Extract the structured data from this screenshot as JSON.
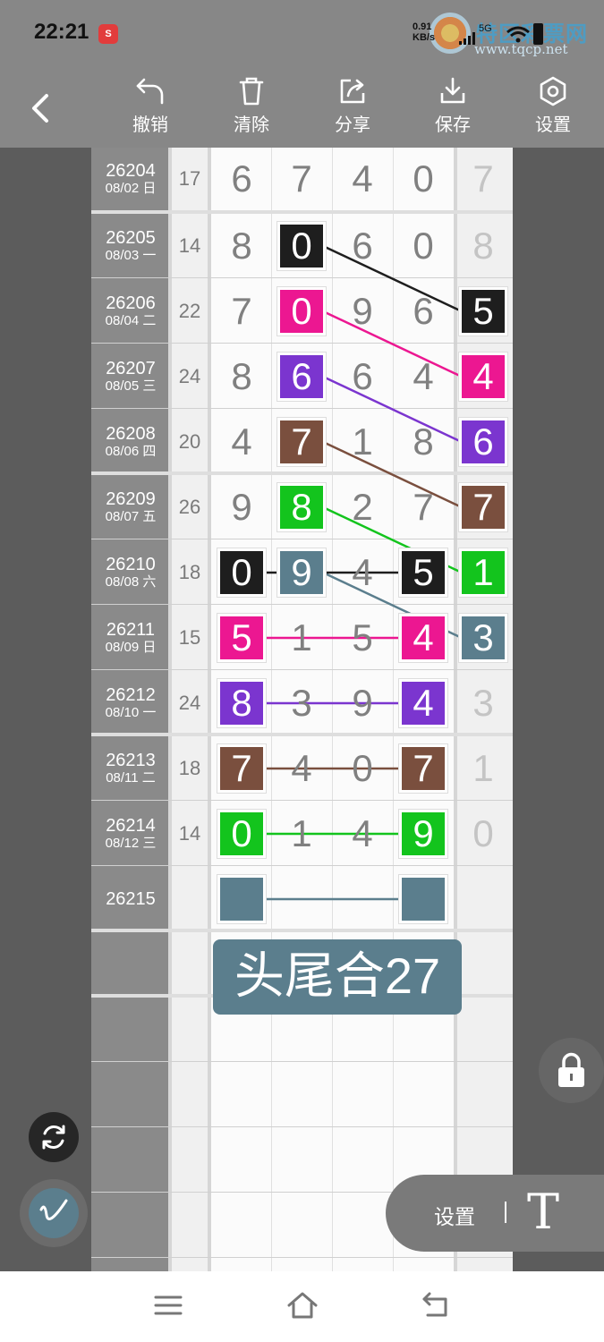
{
  "status_bar": {
    "time": "22:21",
    "app_badge": "S",
    "net_speed": "0.91",
    "net_unit": "KB/s",
    "signal": "5G",
    "watermark_title": "特区彩票网",
    "watermark_url": "www.tqcp.net"
  },
  "toolbar": {
    "undo_label": "撤销",
    "clear_label": "清除",
    "share_label": "分享",
    "save_label": "保存",
    "settings_label": "设置"
  },
  "colors": {
    "black": "#1e1e1e",
    "magenta": "#ec1791",
    "purple": "#7b35cf",
    "brown": "#7a4f3e",
    "green": "#13c41d",
    "teal": "#5b7e8d"
  },
  "rows": [
    {
      "issue": "26204",
      "date": "08/02 日",
      "sum": "17",
      "digits": [
        "6",
        "7",
        "4",
        "0"
      ],
      "tail": "7",
      "hl": [
        null,
        null,
        null,
        null
      ],
      "tail_hl": null
    },
    {
      "issue": "26205",
      "date": "08/03 一",
      "sum": "14",
      "digits": [
        "8",
        "0",
        "6",
        "0"
      ],
      "tail": "8",
      "hl": [
        null,
        "black",
        null,
        null
      ],
      "tail_hl": null
    },
    {
      "issue": "26206",
      "date": "08/04 二",
      "sum": "22",
      "digits": [
        "7",
        "0",
        "9",
        "6"
      ],
      "tail": "5",
      "hl": [
        null,
        "magenta",
        null,
        null
      ],
      "tail_hl": "black"
    },
    {
      "issue": "26207",
      "date": "08/05 三",
      "sum": "24",
      "digits": [
        "8",
        "6",
        "6",
        "4"
      ],
      "tail": "4",
      "hl": [
        null,
        "purple",
        null,
        null
      ],
      "tail_hl": "magenta"
    },
    {
      "issue": "26208",
      "date": "08/06 四",
      "sum": "20",
      "digits": [
        "4",
        "7",
        "1",
        "8"
      ],
      "tail": "6",
      "hl": [
        null,
        "brown",
        null,
        null
      ],
      "tail_hl": "purple"
    },
    {
      "issue": "26209",
      "date": "08/07 五",
      "sum": "26",
      "digits": [
        "9",
        "8",
        "2",
        "7"
      ],
      "tail": "7",
      "hl": [
        null,
        "green",
        null,
        null
      ],
      "tail_hl": "brown"
    },
    {
      "issue": "26210",
      "date": "08/08 六",
      "sum": "18",
      "digits": [
        "0",
        "9",
        "4",
        "5"
      ],
      "tail": "1",
      "hl": [
        "black",
        "teal",
        null,
        "black"
      ],
      "tail_hl": "green"
    },
    {
      "issue": "26211",
      "date": "08/09 日",
      "sum": "15",
      "digits": [
        "5",
        "1",
        "5",
        "4"
      ],
      "tail": "3",
      "hl": [
        "magenta",
        null,
        null,
        "magenta"
      ],
      "tail_hl": "teal"
    },
    {
      "issue": "26212",
      "date": "08/10 一",
      "sum": "24",
      "digits": [
        "8",
        "3",
        "9",
        "4"
      ],
      "tail": "3",
      "hl": [
        "purple",
        null,
        null,
        "purple"
      ],
      "tail_hl": null
    },
    {
      "issue": "26213",
      "date": "08/11 二",
      "sum": "18",
      "digits": [
        "7",
        "4",
        "0",
        "7"
      ],
      "tail": "1",
      "hl": [
        "brown",
        null,
        null,
        "brown"
      ],
      "tail_hl": null
    },
    {
      "issue": "26214",
      "date": "08/12 三",
      "sum": "14",
      "digits": [
        "0",
        "1",
        "4",
        "9"
      ],
      "tail": "0",
      "hl": [
        "green",
        null,
        null,
        "green"
      ],
      "tail_hl": null
    },
    {
      "issue": "26215",
      "date": "",
      "sum": "",
      "digits": [
        "",
        "",
        "",
        ""
      ],
      "tail": "",
      "hl": [
        "teal",
        null,
        null,
        "teal"
      ],
      "tail_hl": null
    }
  ],
  "annotation": "头尾合27",
  "bottom_controls": {
    "settings_label": "设置",
    "text_tool_glyph": "T"
  }
}
